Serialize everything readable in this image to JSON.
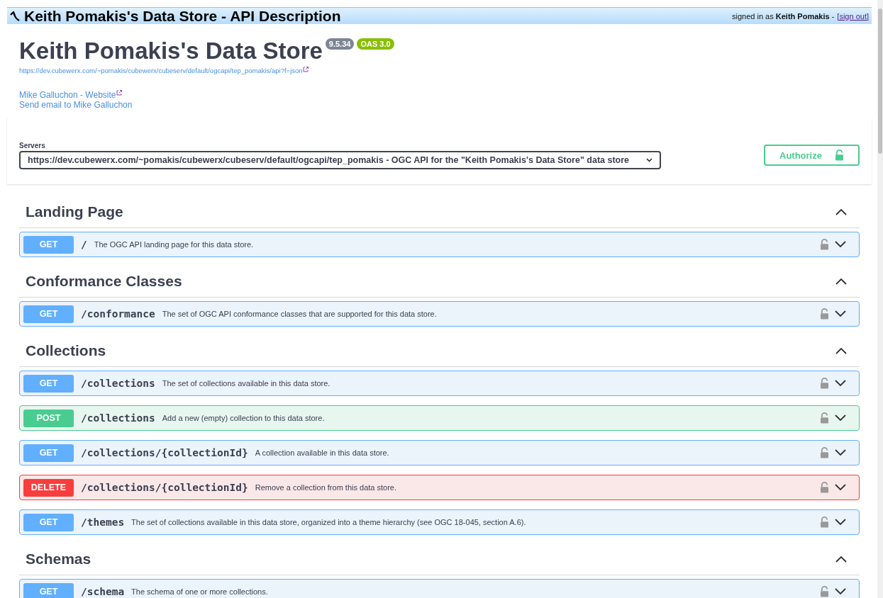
{
  "topbar": {
    "title": "Keith Pomakis's Data Store - API Description",
    "signed_in_prefix": "signed in as",
    "user": "Keith Pomakis",
    "separator": "-",
    "sign_out": "[sign out]"
  },
  "info": {
    "title": "Keith Pomakis's Data Store",
    "version": "9.5.34",
    "oas": "OAS 3.0",
    "url": "https://dev.cubewerx.com/~pomakis/cubewerx/cubeserv/default/ogcapi/tep_pomakis/api?f=json",
    "contact_website": "Mike Galluchon - Website",
    "contact_email": "Send email to Mike Galluchon"
  },
  "servers": {
    "label": "Servers",
    "value": "https://dev.cubewerx.com/~pomakis/cubewerx/cubeserv/default/ogcapi/tep_pomakis - OGC API for the \"Keith Pomakis's Data Store\" data store"
  },
  "authorize": "Authorize",
  "sections": [
    {
      "title": "Landing Page",
      "expanded": true,
      "operations": [
        {
          "kind": "get",
          "method": "GET",
          "path": "/",
          "summary": "The OGC API landing page for this data store.",
          "expanded": false
        }
      ]
    },
    {
      "title": "Conformance Classes",
      "expanded": true,
      "operations": [
        {
          "kind": "get",
          "method": "GET",
          "path": "/conformance",
          "summary": "The set of OGC API conformance classes that are supported for this data store.",
          "expanded": false
        }
      ]
    },
    {
      "title": "Collections",
      "expanded": true,
      "operations": [
        {
          "kind": "get",
          "method": "GET",
          "path": "/collections",
          "summary": "The set of collections available in this data store.",
          "expanded": false
        },
        {
          "kind": "post",
          "method": "POST",
          "path": "/collections",
          "summary": "Add a new (empty) collection to this data store.",
          "expanded": false
        },
        {
          "kind": "get",
          "method": "GET",
          "path": "/collections/{collectionId}",
          "summary": "A collection available in this data store.",
          "expanded": false
        },
        {
          "kind": "delete",
          "method": "DELETE",
          "path": "/collections/{collectionId}",
          "summary": "Remove a collection from this data store.",
          "expanded": false
        },
        {
          "kind": "get",
          "method": "GET",
          "path": "/themes",
          "summary": "The set of collections available in this data store, organized into a theme hierarchy (see OGC 18-045, section A.6).",
          "expanded": false
        }
      ]
    },
    {
      "title": "Schemas",
      "expanded": true,
      "operations": [
        {
          "kind": "get",
          "method": "GET",
          "path": "/schema",
          "summary": "The schema of one or more collections.",
          "expanded": false
        }
      ]
    }
  ]
}
